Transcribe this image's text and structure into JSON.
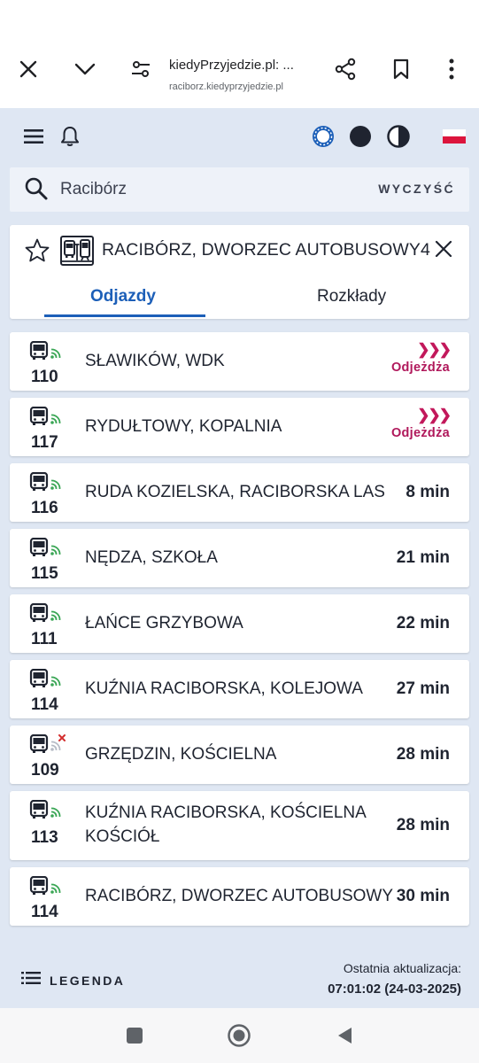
{
  "browser": {
    "tab_title": "kiedyPrzyjedzie.pl: ...",
    "url": "raciborz.kiedyprzyjedzie.pl",
    "icons": [
      "close-icon",
      "chevron-down-icon",
      "site-settings-icon",
      "share-icon",
      "bookmark-icon",
      "more-vert-icon"
    ]
  },
  "header": {
    "icons": [
      "menu-icon",
      "bell-icon",
      "contrast-ring-icon",
      "dark-mode-icon",
      "high-contrast-icon",
      "poland-flag-icon"
    ]
  },
  "search": {
    "value": "Racibórz",
    "clear_label": "WYCZYŚĆ"
  },
  "stop": {
    "name": "RACIBÓRZ, DWORZEC AUTOBUSOWY4",
    "tabs": [
      {
        "label": "Odjazdy",
        "active": true
      },
      {
        "label": "Rozkłady",
        "active": false
      }
    ]
  },
  "departures": [
    {
      "line": "110",
      "destination": "SŁAWIKÓW, WDK",
      "time": "",
      "status": "Odjeżdża",
      "realtime": true
    },
    {
      "line": "117",
      "destination": "RYDUŁTOWY, KOPALNIA",
      "time": "",
      "status": "Odjeżdża",
      "realtime": true
    },
    {
      "line": "116",
      "destination": "RUDA KOZIELSKA, RACIBORSKA LAS",
      "time": "8 min",
      "status": "",
      "realtime": true
    },
    {
      "line": "115",
      "destination": "NĘDZA, SZKOŁA",
      "time": "21 min",
      "status": "",
      "realtime": true
    },
    {
      "line": "111",
      "destination": "ŁAŃCE GRZYBOWA",
      "time": "22 min",
      "status": "",
      "realtime": true
    },
    {
      "line": "114",
      "destination": "KUŹNIA RACIBORSKA, KOLEJOWA",
      "time": "27 min",
      "status": "",
      "realtime": true
    },
    {
      "line": "109",
      "destination": "GRZĘDZIN, KOŚCIELNA",
      "time": "28 min",
      "status": "",
      "realtime": false
    },
    {
      "line": "113",
      "destination": "KUŹNIA RACIBORSKA, KOŚCIELNA KOŚCIÓŁ",
      "time": "28 min",
      "status": "",
      "realtime": true
    },
    {
      "line": "114",
      "destination": "RACIBÓRZ, DWORZEC AUTOBUSOWY",
      "time": "30 min",
      "status": "",
      "realtime": true
    }
  ],
  "footer": {
    "legend_label": "LEGENDA",
    "update_label": "Ostatnia aktualizacja:",
    "update_value": "07:01:02 (24-03-2025)"
  },
  "colors": {
    "accent": "#1c5fb8",
    "leaving": "#b0185b",
    "realtime": "#3aa655",
    "no_realtime": "#d32f2f",
    "background": "#dfe7f3"
  }
}
